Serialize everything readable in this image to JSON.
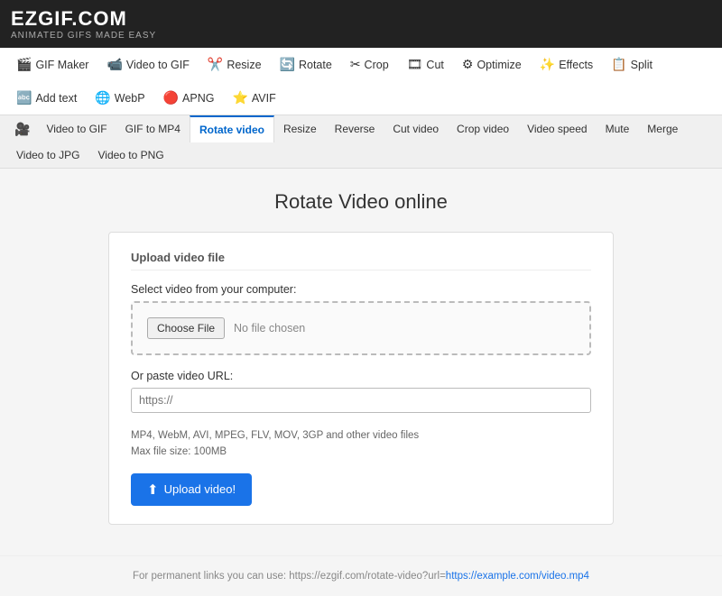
{
  "header": {
    "logo": "EZGIF.COM",
    "tagline": "Animated GIFs Made Easy"
  },
  "mainNav": {
    "items": [
      {
        "id": "gif-maker",
        "icon": "🎬",
        "label": "GIF Maker"
      },
      {
        "id": "video-to-gif",
        "icon": "📹",
        "label": "Video to GIF"
      },
      {
        "id": "resize",
        "icon": "✂️",
        "label": "Resize"
      },
      {
        "id": "rotate",
        "icon": "🔄",
        "label": "Rotate"
      },
      {
        "id": "crop",
        "icon": "✂",
        "label": "Crop"
      },
      {
        "id": "cut",
        "icon": "🎞",
        "label": "Cut"
      },
      {
        "id": "optimize",
        "icon": "⚙",
        "label": "Optimize"
      },
      {
        "id": "effects",
        "icon": "✨",
        "label": "Effects"
      },
      {
        "id": "split",
        "icon": "📋",
        "label": "Split"
      },
      {
        "id": "add-text",
        "icon": "🔤",
        "label": "Add text"
      },
      {
        "id": "webp",
        "icon": "🌐",
        "label": "WebP"
      },
      {
        "id": "apng",
        "icon": "🔴",
        "label": "APNG"
      },
      {
        "id": "avif",
        "icon": "⭐",
        "label": "AVIF"
      }
    ]
  },
  "subNav": {
    "items": [
      {
        "id": "video-to-gif",
        "label": "Video to GIF"
      },
      {
        "id": "gif-to-mp4",
        "label": "GIF to MP4"
      },
      {
        "id": "rotate-video",
        "label": "Rotate video",
        "active": true
      },
      {
        "id": "resize",
        "label": "Resize"
      },
      {
        "id": "reverse",
        "label": "Reverse"
      },
      {
        "id": "cut-video",
        "label": "Cut video"
      },
      {
        "id": "crop-video",
        "label": "Crop video"
      },
      {
        "id": "video-speed",
        "label": "Video speed"
      },
      {
        "id": "mute",
        "label": "Mute"
      },
      {
        "id": "merge",
        "label": "Merge"
      },
      {
        "id": "video-to-jpg",
        "label": "Video to JPG"
      },
      {
        "id": "video-to-png",
        "label": "Video to PNG"
      }
    ]
  },
  "page": {
    "title": "Rotate Video online",
    "card": {
      "title": "Upload video file",
      "selectLabel": "Select video from your computer:",
      "chooseFileBtn": "Choose File",
      "noFileChosen": "No file chosen",
      "urlLabel": "Or paste video URL:",
      "urlPlaceholder": "https://",
      "infoLine1": "MP4, WebM, AVI, MPEG, FLV, MOV, 3GP and other video files",
      "infoLine2": "Max file size: 100MB",
      "uploadBtn": "Upload video!"
    },
    "footer": {
      "text": "For permanent links you can use: https://ezgif.com/rotate-video?url=",
      "linkText": "https://example.com/video.mp4",
      "linkHref": "https://example.com/video.mp4"
    }
  }
}
